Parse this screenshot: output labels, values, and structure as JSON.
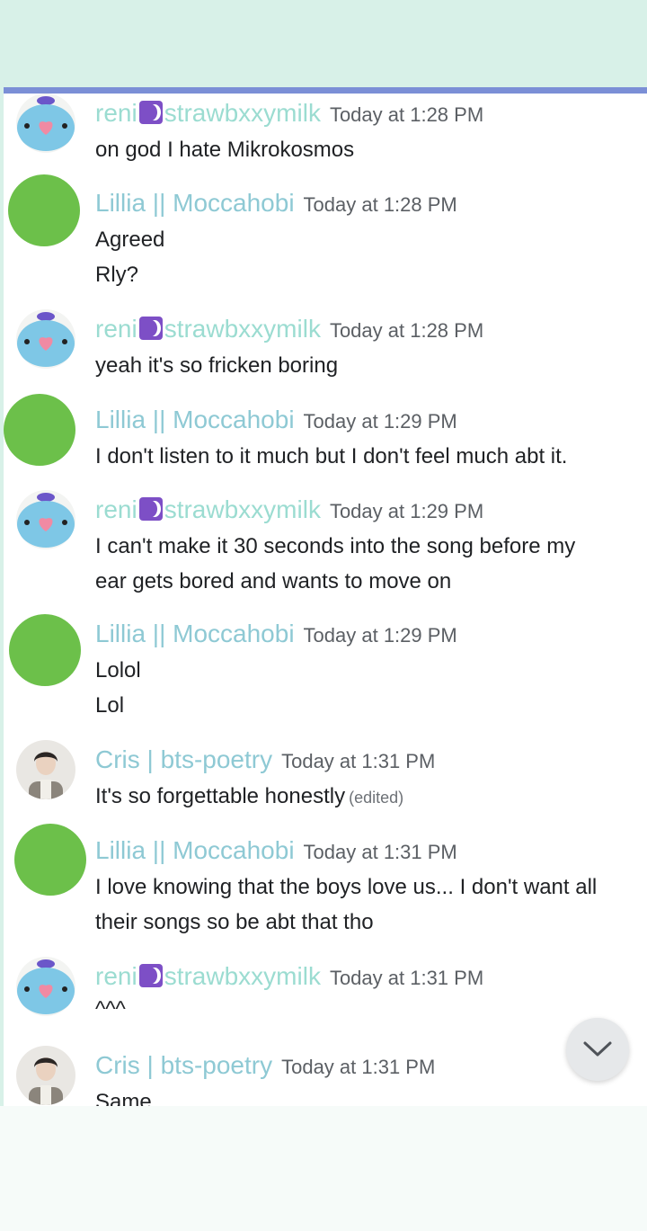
{
  "messages": [
    {
      "author": "reni",
      "author_tail": "strawbxxymilk",
      "avatar": "mang-plush-avatar",
      "time": "Today at 1:28 PM",
      "lines": [
        "on god I hate Mikrokosmos"
      ]
    },
    {
      "author": "Lillia || Moccahobi",
      "avatar": "green-circle-avatar",
      "time": "Today at 1:28 PM",
      "lines": [
        "Agreed",
        "Rly?"
      ]
    },
    {
      "author": "reni",
      "author_tail": "strawbxxymilk",
      "avatar": "mang-plush-avatar",
      "time": "Today at 1:28 PM",
      "lines": [
        "yeah it's so fricken boring"
      ]
    },
    {
      "author": "Lillia || Moccahobi",
      "avatar": "green-circle-avatar",
      "time": "Today at 1:29 PM",
      "lines": [
        "I don't listen to it much but I don't feel much abt it."
      ]
    },
    {
      "author": "reni",
      "author_tail": "strawbxxymilk",
      "avatar": "mang-plush-avatar",
      "time": "Today at 1:29 PM",
      "lines": [
        "I can't make it 30 seconds into the song before my",
        "ear gets bored and wants to move on"
      ]
    },
    {
      "author": "Lillia || Moccahobi",
      "avatar": "green-circle-avatar",
      "time": "Today at 1:29 PM",
      "lines": [
        "Lolol",
        "Lol"
      ]
    },
    {
      "author": "Cris | bts-poetry",
      "avatar": "person-photo-avatar",
      "time": "Today at 1:31 PM",
      "lines": [
        "It's so forgettable honestly"
      ],
      "edited": "(edited)"
    },
    {
      "author": "Lillia || Moccahobi",
      "avatar": "green-circle-avatar",
      "time": "Today at 1:31 PM",
      "lines": [
        "I love knowing that the boys love us... I don't want all",
        "their songs so be abt that tho"
      ]
    },
    {
      "author": "reni",
      "author_tail": "strawbxxymilk",
      "avatar": "mang-plush-avatar",
      "time": "Today at 1:31 PM",
      "lines": [
        "^^^"
      ]
    },
    {
      "author": "Cris | bts-poetry",
      "avatar": "person-photo-avatar",
      "time": "Today at 1:31 PM",
      "lines": [
        "Same"
      ]
    }
  ],
  "scroll_button": {
    "icon": "chevron-down-icon"
  },
  "colors": {
    "top_band": "#d8f1e8",
    "top_bar": "#7b8fd6",
    "name": "#8ec9d4",
    "green_avatar": "#6cc04a"
  }
}
